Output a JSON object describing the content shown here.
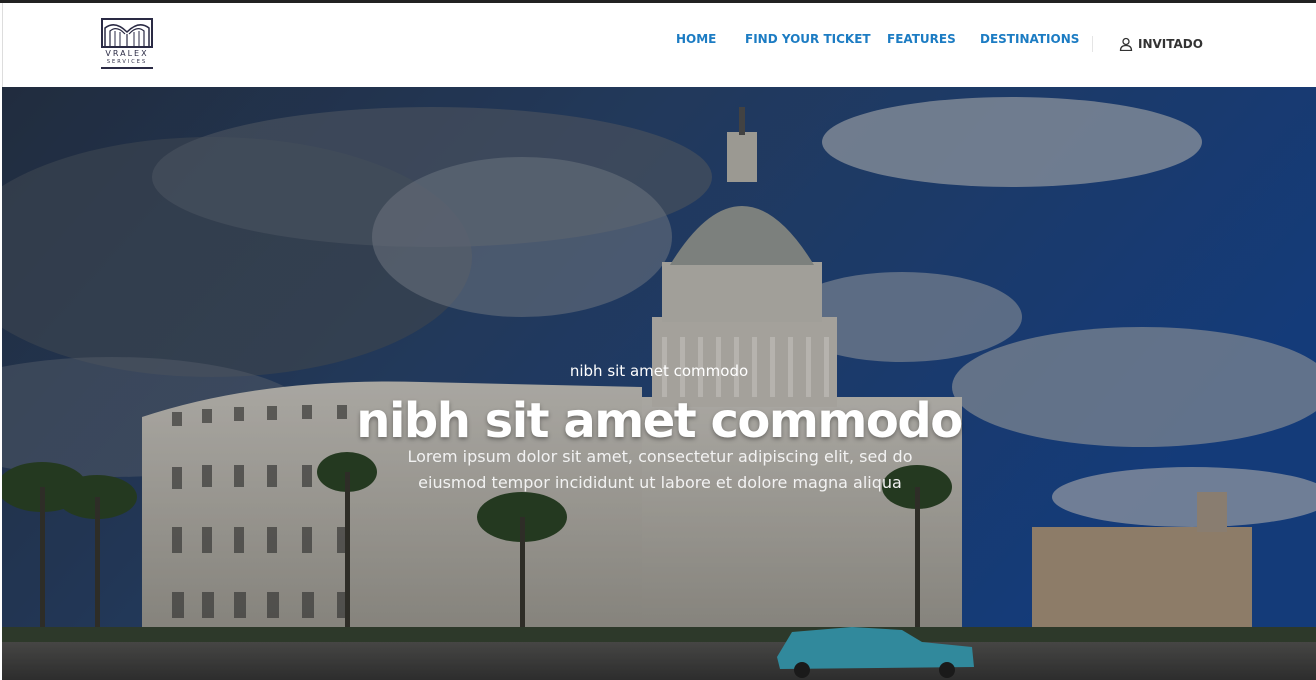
{
  "brand": {
    "logo_name": "VRALEX",
    "logo_sub": "SERVICES"
  },
  "nav": {
    "items": [
      {
        "label": "HOME"
      },
      {
        "label": "FIND YOUR TICKET"
      },
      {
        "label": "FEATURES"
      },
      {
        "label": "DESTINATIONS"
      }
    ],
    "user_label": "INVITADO"
  },
  "hero": {
    "kicker": "nibh sit amet commodo",
    "title": "nibh sit amet commodo",
    "text": "Lorem ipsum dolor sit amet, consectetur adipiscing elit, sed do eiusmod tempor incididunt ut labore et dolore magna aliqua"
  },
  "colors": {
    "nav_link": "#1c7cc3",
    "user_text": "#333333",
    "hero_text": "#ffffff",
    "logo": "#2a2a44"
  }
}
